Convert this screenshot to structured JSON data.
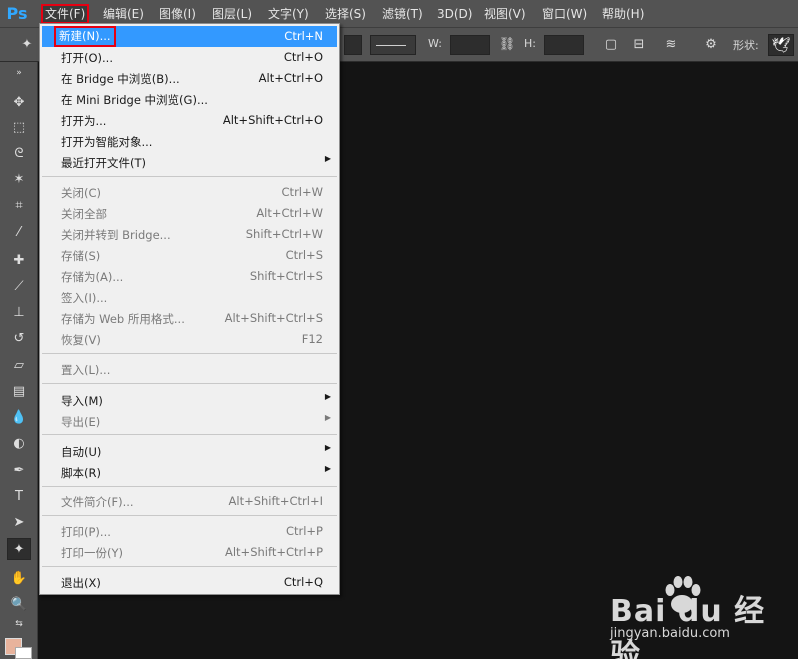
{
  "app": {
    "logo": "Ps"
  },
  "menubar": {
    "items": [
      {
        "label": "文件(F)"
      },
      {
        "label": "编辑(E)"
      },
      {
        "label": "图像(I)"
      },
      {
        "label": "图层(L)"
      },
      {
        "label": "文字(Y)"
      },
      {
        "label": "选择(S)"
      },
      {
        "label": "滤镜(T)"
      },
      {
        "label": "3D(D)"
      },
      {
        "label": "视图(V)"
      },
      {
        "label": "窗口(W)"
      },
      {
        "label": "帮助(H)"
      }
    ]
  },
  "options": {
    "w_label": "W:",
    "h_label": "H:",
    "shape_label": "形状:"
  },
  "file_menu": {
    "items": [
      {
        "label": "新建(N)...",
        "shortcut": "Ctrl+N"
      },
      {
        "label": "打开(O)...",
        "shortcut": "Ctrl+O"
      },
      {
        "label": "在 Bridge 中浏览(B)...",
        "shortcut": "Alt+Ctrl+O"
      },
      {
        "label": "在 Mini Bridge 中浏览(G)...",
        "shortcut": ""
      },
      {
        "label": "打开为...",
        "shortcut": "Alt+Shift+Ctrl+O"
      },
      {
        "label": "打开为智能对象...",
        "shortcut": ""
      },
      {
        "label": "最近打开文件(T)",
        "shortcut": ""
      },
      {
        "label": "关闭(C)",
        "shortcut": "Ctrl+W"
      },
      {
        "label": "关闭全部",
        "shortcut": "Alt+Ctrl+W"
      },
      {
        "label": "关闭并转到 Bridge...",
        "shortcut": "Shift+Ctrl+W"
      },
      {
        "label": "存储(S)",
        "shortcut": "Ctrl+S"
      },
      {
        "label": "存储为(A)...",
        "shortcut": "Shift+Ctrl+S"
      },
      {
        "label": "签入(I)...",
        "shortcut": ""
      },
      {
        "label": "存储为 Web 所用格式...",
        "shortcut": "Alt+Shift+Ctrl+S"
      },
      {
        "label": "恢复(V)",
        "shortcut": "F12"
      },
      {
        "label": "置入(L)...",
        "shortcut": ""
      },
      {
        "label": "导入(M)",
        "shortcut": ""
      },
      {
        "label": "导出(E)",
        "shortcut": ""
      },
      {
        "label": "自动(U)",
        "shortcut": ""
      },
      {
        "label": "脚本(R)",
        "shortcut": ""
      },
      {
        "label": "文件简介(F)...",
        "shortcut": "Alt+Shift+Ctrl+I"
      },
      {
        "label": "打印(P)...",
        "shortcut": "Ctrl+P"
      },
      {
        "label": "打印一份(Y)",
        "shortcut": "Alt+Shift+Ctrl+P"
      },
      {
        "label": "退出(X)",
        "shortcut": "Ctrl+Q"
      }
    ]
  },
  "colors": {
    "foreground": "#e8b39c",
    "background": "#ffffff",
    "menu_highlight": "#3399ff",
    "annotation_box": "#e60012"
  },
  "watermark": {
    "main": "Bai du 经验",
    "sub": "jingyan.baidu.com"
  }
}
